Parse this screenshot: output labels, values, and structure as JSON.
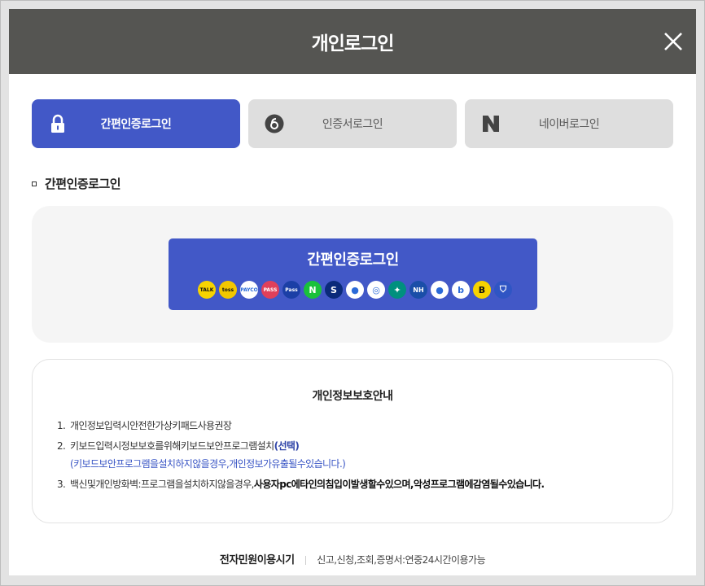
{
  "header": {
    "title": "개인로그인"
  },
  "tabs": [
    {
      "label": "간편인증로그인",
      "icon": "lock-icon",
      "active": true
    },
    {
      "label": "인증서로그인",
      "icon": "certificate-icon",
      "active": false
    },
    {
      "label": "네이버로그인",
      "icon": "naver-icon",
      "active": false
    }
  ],
  "section": {
    "title": "간편인증로그인"
  },
  "easy_login": {
    "button_label": "간편인증로그인",
    "providers": [
      {
        "name": "kakao-icon",
        "text": "TALK",
        "color": "#f7d300"
      },
      {
        "name": "toss-icon",
        "text": "toss",
        "color": "#f2c700"
      },
      {
        "name": "payco-icon",
        "text": "PAYCO",
        "color": "#ffffff"
      },
      {
        "name": "pass-icon",
        "text": "PASS",
        "color": "#e0405a"
      },
      {
        "name": "samsung-pass-icon",
        "text": "Pass",
        "color": "#1b3fa6"
      },
      {
        "name": "naver-icon",
        "text": "N",
        "color": "#19c13b"
      },
      {
        "name": "shinhan-icon",
        "text": "S",
        "color": "#0a2a7a"
      },
      {
        "name": "toss-bank-icon",
        "text": "●",
        "color": "#ffffff"
      },
      {
        "name": "woori-icon",
        "text": "◎",
        "color": "#ffffff"
      },
      {
        "name": "hana-icon",
        "text": "✦",
        "color": "#00907e"
      },
      {
        "name": "nh-icon",
        "text": "NH",
        "color": "#1a4ea8"
      },
      {
        "name": "kb-icon",
        "text": "●",
        "color": "#ffffff"
      },
      {
        "name": "banksalad-icon",
        "text": "b",
        "color": "#ffffff"
      },
      {
        "name": "kakaobank-icon",
        "text": "B",
        "color": "#f7d300"
      },
      {
        "name": "shield-icon",
        "text": "⛉",
        "color": "#2f55c4"
      }
    ]
  },
  "notice": {
    "title": "개인정보보호안내",
    "items": [
      {
        "num": "1.",
        "text": "개인정보입력시안전한가상키패드사용권장"
      },
      {
        "num": "2.",
        "text": "키보드입력시정보보호를위해키보드보안프로그램설치",
        "highlight": "(선택)",
        "sub": "(키보드보안프로그램을설치하지않을경우,개인정보가유출될수있습니다.)"
      },
      {
        "num": "3.",
        "text": "백신및개인방화벽:프로그램을설치하지않을경우,",
        "bold": "사용자pc에타인의침입이발생할수있으며,악성프로그램에감염될수있습니다."
      }
    ]
  },
  "footer": {
    "title": "전자민원이용시기",
    "text": "신고,신청,조회,증명서:연중24시간이용가능"
  },
  "colors": {
    "header_bg": "#555552",
    "accent": "#4258c7",
    "tab_inactive": "#dedede"
  }
}
